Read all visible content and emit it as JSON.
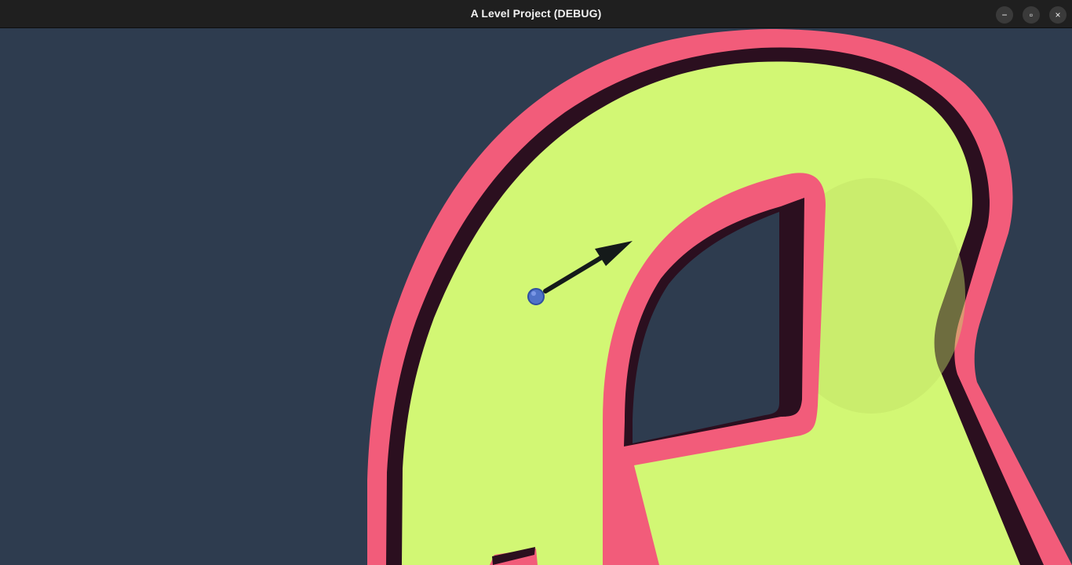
{
  "window": {
    "title": "A Level Project (DEBUG)",
    "controls": {
      "minimize_icon": "minimize-icon",
      "maximize_icon": "restore-icon",
      "close_icon": "close-icon"
    }
  },
  "scene": {
    "background_color": "#2e3c4f",
    "track_surface_color": "#d2f774",
    "track_wall_color": "#f25c7a",
    "track_shadow_color": "#2b0f1f",
    "ball_color": "#4f72c8",
    "aim_arrow_color": "#151a1a"
  }
}
